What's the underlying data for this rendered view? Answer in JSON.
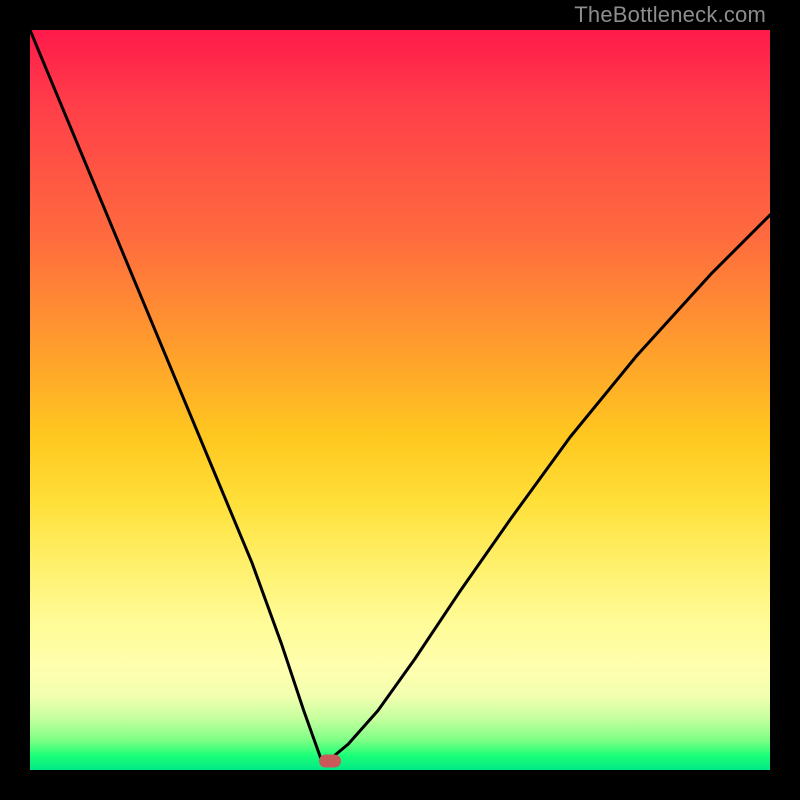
{
  "watermark": "TheBottleneck.com",
  "chart_data": {
    "type": "line",
    "title": "",
    "xlabel": "",
    "ylabel": "",
    "xlim": [
      0,
      1
    ],
    "ylim": [
      0,
      1
    ],
    "x": [
      0.0,
      0.05,
      0.1,
      0.15,
      0.2,
      0.25,
      0.3,
      0.34,
      0.37,
      0.395,
      0.4,
      0.43,
      0.47,
      0.52,
      0.58,
      0.65,
      0.73,
      0.82,
      0.92,
      1.0
    ],
    "y": [
      1.0,
      0.88,
      0.76,
      0.64,
      0.52,
      0.4,
      0.28,
      0.17,
      0.08,
      0.01,
      0.01,
      0.035,
      0.08,
      0.15,
      0.24,
      0.34,
      0.45,
      0.56,
      0.67,
      0.75
    ],
    "optimum_x": 0.405,
    "optimum_y": 0.012,
    "background_map": "red-yellow-green vertical gradient (bottleneck severity)"
  },
  "marker": {
    "semantic": "optimum-point"
  }
}
